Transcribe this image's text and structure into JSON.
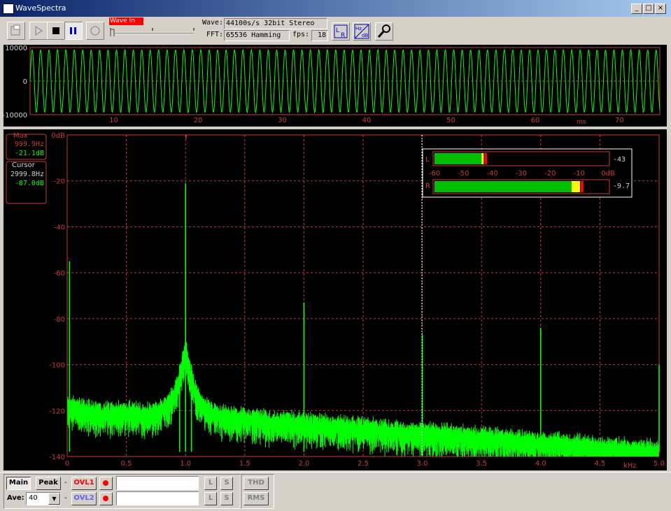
{
  "window": {
    "title": "WaveSpectra"
  },
  "toolbar": {
    "wave_in_label": "Wave In",
    "wave_label": "Wave:",
    "wave_value": "44100s/s 32bit Stereo",
    "fft_label": "FFT:",
    "fft_value": "65536 Hamming",
    "fps_label": "fps:",
    "fps_value": "18",
    "hzdb_label_hz": "Hz",
    "hzdb_label_db": "dB",
    "lr_label_l": "L",
    "lr_label_r": "R"
  },
  "waveform": {
    "y_ticks": [
      "10000",
      "0",
      "-10000"
    ],
    "x_ticks": [
      "10",
      "20",
      "30",
      "40",
      "50",
      "60",
      "70"
    ],
    "x_unit": "ms",
    "color": "#00ff00"
  },
  "spectrum": {
    "max_label": "Max",
    "max_freq": "999.9Hz",
    "max_db": "-21.1dB",
    "cursor_label": "Cursor",
    "cursor_freq": "2999.8Hz",
    "cursor_db": "-87.0dB",
    "y_ticks": [
      "0dB",
      "-20",
      "-40",
      "-60",
      "-80",
      "-100",
      "-120",
      "-140"
    ],
    "x_ticks": [
      "0",
      "0.5",
      "1.0",
      "1.5",
      "2.0",
      "2.5",
      "3.0",
      "3.5",
      "4.0",
      "4.5",
      "5.0"
    ],
    "x_unit": "kHz",
    "grid_color": "#c83c3c",
    "trace_color": "#00ff00"
  },
  "chart_data": {
    "type": "line",
    "xlabel": "kHz",
    "ylabel": "",
    "xlim": [
      0,
      5.0
    ],
    "ylim": [
      -140,
      0
    ],
    "series": [
      {
        "x": [
          0.0,
          0.02,
          0.1,
          0.3,
          0.6,
          0.85,
          0.95,
          1.0,
          1.05,
          1.15,
          1.4,
          1.7,
          1.99,
          2.0,
          2.01,
          2.5,
          2.99,
          3.0,
          3.01,
          3.5,
          3.99,
          4.0,
          4.01,
          4.5,
          4.98,
          5.0
        ],
        "y": [
          -120,
          -55,
          -118,
          -122,
          -118,
          -112,
          -100,
          -21.1,
          -100,
          -112,
          -120,
          -125,
          -128,
          -73,
          -128,
          -130,
          -133,
          -87,
          -133,
          -134,
          -134,
          -84,
          -134,
          -135,
          -136,
          -100
        ]
      }
    ]
  },
  "meter": {
    "left_label": "L",
    "right_label": "R",
    "left_value": "-43",
    "right_value": "-9.7",
    "left_level_db": -43,
    "right_level_db": -9.7,
    "scale": [
      "-60",
      "-50",
      "-40",
      "-30",
      "-20",
      "-10",
      "0dB"
    ]
  },
  "bottom": {
    "main_label": "Main",
    "peak_label": "Peak",
    "ovl1_label": "OVL1",
    "ovl2_label": "OVL2",
    "ave_label": "Ave:",
    "ave_value": "40",
    "l_label": "L",
    "s_label": "S",
    "thd_label": "THD",
    "rms_label": "RMS",
    "dash": "-"
  }
}
